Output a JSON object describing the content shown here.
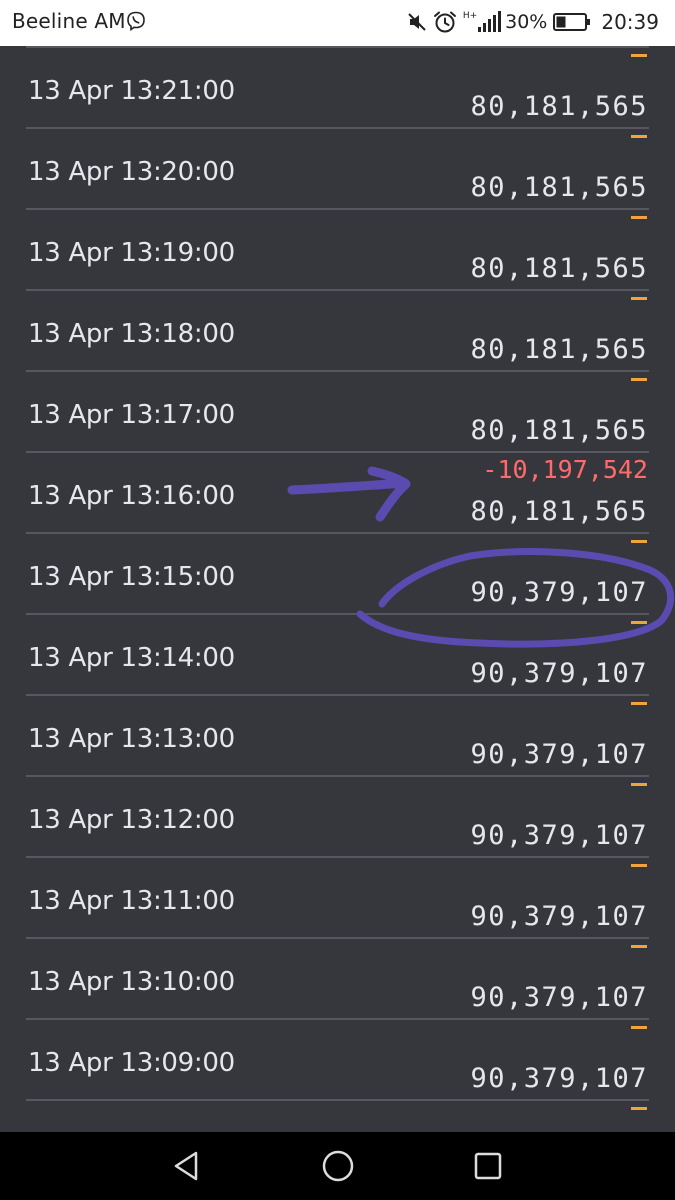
{
  "status_bar": {
    "carrier": "Beeline AM",
    "network": "H+",
    "battery": "30%",
    "time": "20:39"
  },
  "rows": [
    {
      "time": "13 Apr 13:21:00",
      "delta": "—",
      "balance": "80,181,565"
    },
    {
      "time": "13 Apr 13:20:00",
      "delta": "—",
      "balance": "80,181,565"
    },
    {
      "time": "13 Apr 13:19:00",
      "delta": "—",
      "balance": "80,181,565"
    },
    {
      "time": "13 Apr 13:18:00",
      "delta": "—",
      "balance": "80,181,565"
    },
    {
      "time": "13 Apr 13:17:00",
      "delta": "—",
      "balance": "80,181,565"
    },
    {
      "time": "13 Apr 13:16:00",
      "delta": "-10,197,542",
      "balance": "80,181,565"
    },
    {
      "time": "13 Apr 13:15:00",
      "delta": "—",
      "balance": "90,379,107"
    },
    {
      "time": "13 Apr 13:14:00",
      "delta": "—",
      "balance": "90,379,107"
    },
    {
      "time": "13 Apr 13:13:00",
      "delta": "—",
      "balance": "90,379,107"
    },
    {
      "time": "13 Apr 13:12:00",
      "delta": "—",
      "balance": "90,379,107"
    },
    {
      "time": "13 Apr 13:11:00",
      "delta": "—",
      "balance": "90,379,107"
    },
    {
      "time": "13 Apr 13:10:00",
      "delta": "—",
      "balance": "90,379,107"
    },
    {
      "time": "13 Apr 13:09:00",
      "delta": "—",
      "balance": "90,379,107"
    },
    {
      "time": "",
      "delta": "—",
      "balance": ""
    }
  ],
  "colors": {
    "background": "#35373c",
    "text": "#e6e7ea",
    "no_change_dash": "#f0a53a",
    "negative_delta": "#ff6b6b",
    "annotation": "#5b4bb0"
  },
  "icons": {
    "viber": "viber-icon",
    "mute": "mute-icon",
    "alarm": "alarm-icon",
    "signal": "signal-icon",
    "battery": "battery-icon",
    "back": "back-icon",
    "home": "home-icon",
    "recents": "recents-icon"
  }
}
